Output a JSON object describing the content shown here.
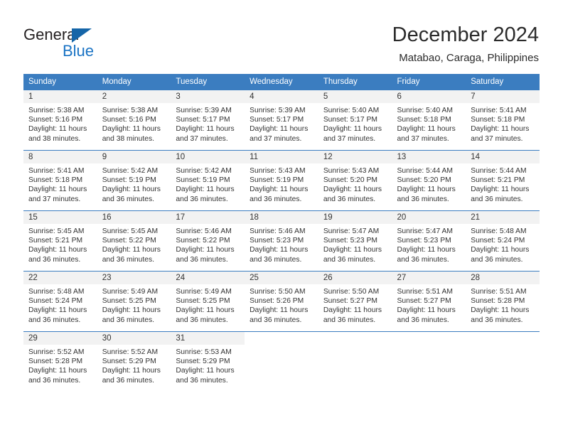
{
  "logo": {
    "word_top": "General",
    "word_bottom": "Blue",
    "accent_color": "#1a73c4",
    "triangle_color": "#1565a8"
  },
  "header": {
    "title": "December 2024",
    "subtitle": "Matabao, Caraga, Philippines"
  },
  "calendar": {
    "header_color": "#3b7dc0",
    "daynum_band_color": "#f2f2f2",
    "weekday_headers": [
      "Sunday",
      "Monday",
      "Tuesday",
      "Wednesday",
      "Thursday",
      "Friday",
      "Saturday"
    ],
    "labels": {
      "sunrise": "Sunrise:",
      "sunset": "Sunset:",
      "daylight": "Daylight:"
    },
    "weeks": [
      [
        {
          "day": "1",
          "sunrise": "Sunrise: 5:38 AM",
          "sunset": "Sunset: 5:16 PM",
          "daylight": "Daylight: 11 hours and 38 minutes."
        },
        {
          "day": "2",
          "sunrise": "Sunrise: 5:38 AM",
          "sunset": "Sunset: 5:16 PM",
          "daylight": "Daylight: 11 hours and 38 minutes."
        },
        {
          "day": "3",
          "sunrise": "Sunrise: 5:39 AM",
          "sunset": "Sunset: 5:17 PM",
          "daylight": "Daylight: 11 hours and 37 minutes."
        },
        {
          "day": "4",
          "sunrise": "Sunrise: 5:39 AM",
          "sunset": "Sunset: 5:17 PM",
          "daylight": "Daylight: 11 hours and 37 minutes."
        },
        {
          "day": "5",
          "sunrise": "Sunrise: 5:40 AM",
          "sunset": "Sunset: 5:17 PM",
          "daylight": "Daylight: 11 hours and 37 minutes."
        },
        {
          "day": "6",
          "sunrise": "Sunrise: 5:40 AM",
          "sunset": "Sunset: 5:18 PM",
          "daylight": "Daylight: 11 hours and 37 minutes."
        },
        {
          "day": "7",
          "sunrise": "Sunrise: 5:41 AM",
          "sunset": "Sunset: 5:18 PM",
          "daylight": "Daylight: 11 hours and 37 minutes."
        }
      ],
      [
        {
          "day": "8",
          "sunrise": "Sunrise: 5:41 AM",
          "sunset": "Sunset: 5:18 PM",
          "daylight": "Daylight: 11 hours and 37 minutes."
        },
        {
          "day": "9",
          "sunrise": "Sunrise: 5:42 AM",
          "sunset": "Sunset: 5:19 PM",
          "daylight": "Daylight: 11 hours and 36 minutes."
        },
        {
          "day": "10",
          "sunrise": "Sunrise: 5:42 AM",
          "sunset": "Sunset: 5:19 PM",
          "daylight": "Daylight: 11 hours and 36 minutes."
        },
        {
          "day": "11",
          "sunrise": "Sunrise: 5:43 AM",
          "sunset": "Sunset: 5:19 PM",
          "daylight": "Daylight: 11 hours and 36 minutes."
        },
        {
          "day": "12",
          "sunrise": "Sunrise: 5:43 AM",
          "sunset": "Sunset: 5:20 PM",
          "daylight": "Daylight: 11 hours and 36 minutes."
        },
        {
          "day": "13",
          "sunrise": "Sunrise: 5:44 AM",
          "sunset": "Sunset: 5:20 PM",
          "daylight": "Daylight: 11 hours and 36 minutes."
        },
        {
          "day": "14",
          "sunrise": "Sunrise: 5:44 AM",
          "sunset": "Sunset: 5:21 PM",
          "daylight": "Daylight: 11 hours and 36 minutes."
        }
      ],
      [
        {
          "day": "15",
          "sunrise": "Sunrise: 5:45 AM",
          "sunset": "Sunset: 5:21 PM",
          "daylight": "Daylight: 11 hours and 36 minutes."
        },
        {
          "day": "16",
          "sunrise": "Sunrise: 5:45 AM",
          "sunset": "Sunset: 5:22 PM",
          "daylight": "Daylight: 11 hours and 36 minutes."
        },
        {
          "day": "17",
          "sunrise": "Sunrise: 5:46 AM",
          "sunset": "Sunset: 5:22 PM",
          "daylight": "Daylight: 11 hours and 36 minutes."
        },
        {
          "day": "18",
          "sunrise": "Sunrise: 5:46 AM",
          "sunset": "Sunset: 5:23 PM",
          "daylight": "Daylight: 11 hours and 36 minutes."
        },
        {
          "day": "19",
          "sunrise": "Sunrise: 5:47 AM",
          "sunset": "Sunset: 5:23 PM",
          "daylight": "Daylight: 11 hours and 36 minutes."
        },
        {
          "day": "20",
          "sunrise": "Sunrise: 5:47 AM",
          "sunset": "Sunset: 5:23 PM",
          "daylight": "Daylight: 11 hours and 36 minutes."
        },
        {
          "day": "21",
          "sunrise": "Sunrise: 5:48 AM",
          "sunset": "Sunset: 5:24 PM",
          "daylight": "Daylight: 11 hours and 36 minutes."
        }
      ],
      [
        {
          "day": "22",
          "sunrise": "Sunrise: 5:48 AM",
          "sunset": "Sunset: 5:24 PM",
          "daylight": "Daylight: 11 hours and 36 minutes."
        },
        {
          "day": "23",
          "sunrise": "Sunrise: 5:49 AM",
          "sunset": "Sunset: 5:25 PM",
          "daylight": "Daylight: 11 hours and 36 minutes."
        },
        {
          "day": "24",
          "sunrise": "Sunrise: 5:49 AM",
          "sunset": "Sunset: 5:25 PM",
          "daylight": "Daylight: 11 hours and 36 minutes."
        },
        {
          "day": "25",
          "sunrise": "Sunrise: 5:50 AM",
          "sunset": "Sunset: 5:26 PM",
          "daylight": "Daylight: 11 hours and 36 minutes."
        },
        {
          "day": "26",
          "sunrise": "Sunrise: 5:50 AM",
          "sunset": "Sunset: 5:27 PM",
          "daylight": "Daylight: 11 hours and 36 minutes."
        },
        {
          "day": "27",
          "sunrise": "Sunrise: 5:51 AM",
          "sunset": "Sunset: 5:27 PM",
          "daylight": "Daylight: 11 hours and 36 minutes."
        },
        {
          "day": "28",
          "sunrise": "Sunrise: 5:51 AM",
          "sunset": "Sunset: 5:28 PM",
          "daylight": "Daylight: 11 hours and 36 minutes."
        }
      ],
      [
        {
          "day": "29",
          "sunrise": "Sunrise: 5:52 AM",
          "sunset": "Sunset: 5:28 PM",
          "daylight": "Daylight: 11 hours and 36 minutes."
        },
        {
          "day": "30",
          "sunrise": "Sunrise: 5:52 AM",
          "sunset": "Sunset: 5:29 PM",
          "daylight": "Daylight: 11 hours and 36 minutes."
        },
        {
          "day": "31",
          "sunrise": "Sunrise: 5:53 AM",
          "sunset": "Sunset: 5:29 PM",
          "daylight": "Daylight: 11 hours and 36 minutes."
        },
        null,
        null,
        null,
        null
      ]
    ]
  }
}
